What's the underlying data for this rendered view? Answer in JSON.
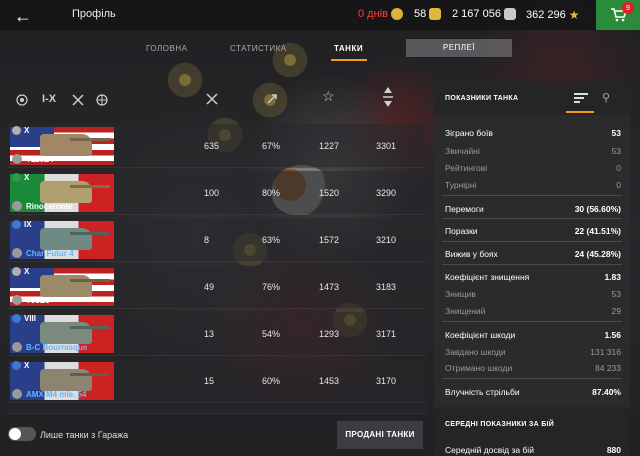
{
  "header": {
    "title": "Профіль",
    "premium_days": "0 днів",
    "gold": "58",
    "credits": "2 167 056",
    "free_xp": "362 296",
    "cart_badge": "9"
  },
  "tabs": [
    "ГОЛОВНА",
    "СТАТИСТИКА",
    "ТАНКИ"
  ],
  "active_tab": "ТАНКИ",
  "replay_label": "РЕПЛЕЇ",
  "filters": {
    "tier_label": "I-X"
  },
  "tanks": [
    {
      "tier": "X",
      "name": "T110E4",
      "name_color": "#ffffff",
      "flag": "usa",
      "col1": "635",
      "col2": "67%",
      "col3": "1227",
      "col4": "3301"
    },
    {
      "tier": "X",
      "name": "Rinoceronte",
      "name_color": "#ffffff",
      "flag": "italy",
      "col1": "100",
      "col2": "80%",
      "col3": "1520",
      "col4": "3290"
    },
    {
      "tier": "IX",
      "name": "Char Futur 4",
      "name_color": "#64b4ff",
      "flag": "france",
      "col1": "8",
      "col2": "63%",
      "col3": "1572",
      "col4": "3210"
    },
    {
      "tier": "X",
      "name": "T95E6",
      "name_color": "#ffffff",
      "flag": "usa",
      "col1": "49",
      "col2": "76%",
      "col3": "1473",
      "col4": "3183"
    },
    {
      "tier": "VIII",
      "name": "B-C Bourrasque",
      "name_color": "#64b4ff",
      "flag": "france",
      "col1": "13",
      "col2": "54%",
      "col3": "1293",
      "col4": "3171"
    },
    {
      "tier": "X",
      "name": "AMX M4 mle. 54",
      "name_color": "#64b4ff",
      "flag": "france",
      "col1": "15",
      "col2": "60%",
      "col3": "1453",
      "col4": "3170"
    }
  ],
  "panel": {
    "title": "ПОКАЗНИКИ ТАНКА",
    "stats": [
      {
        "label": "Зіграно боїв",
        "value": "53",
        "type": "main"
      },
      {
        "label": "Звичайні",
        "value": "53",
        "type": "sub"
      },
      {
        "label": "Рейтингові",
        "value": "0",
        "type": "sub"
      },
      {
        "label": "Турнірні",
        "value": "0",
        "type": "sub"
      },
      {
        "label": "Перемоги",
        "value": "30 (56.60%)",
        "type": "main"
      },
      {
        "label": "Поразки",
        "value": "22 (41.51%)",
        "type": "main"
      },
      {
        "label": "Вижив у боях",
        "value": "24 (45.28%)",
        "type": "main"
      },
      {
        "label": "Коефіцієнт знищення",
        "value": "1.83",
        "type": "main"
      },
      {
        "label": "Знищив",
        "value": "53",
        "type": "sub"
      },
      {
        "label": "Знищений",
        "value": "29",
        "type": "sub"
      },
      {
        "label": "Коефіцієнт шкоди",
        "value": "1.56",
        "type": "main"
      },
      {
        "label": "Завдано шкоди",
        "value": "131 316",
        "type": "sub"
      },
      {
        "label": "Отримано шкоди",
        "value": "84 233",
        "type": "sub"
      },
      {
        "label": "Влучність стрільби",
        "value": "87.40%",
        "type": "main"
      }
    ],
    "section2_title": "СЕРЕДНІ ПОКАЗНИКИ ЗА БІЙ",
    "section2_first_label": "Середній досвід за бій",
    "section2_first_value": "880"
  },
  "garage_toggle_label": "Лише танки з Гаража",
  "sold_button": "ПРОДАНІ ТАНКИ",
  "colors": {
    "accent": "#f39a1b",
    "cart": "#2a8c3a",
    "premium": "#ff3b30"
  }
}
